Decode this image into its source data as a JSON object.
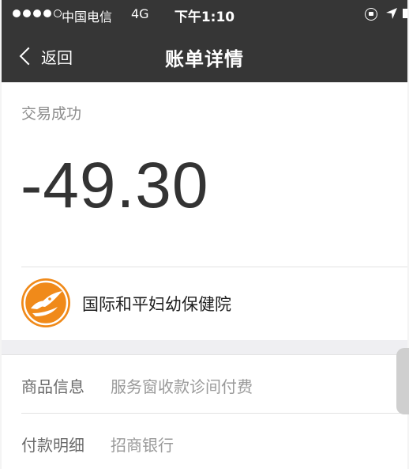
{
  "status_bar": {
    "carrier": "中国电信",
    "network": "4G",
    "time": "下午1:10"
  },
  "nav": {
    "back_label": "返回",
    "title": "账单详情"
  },
  "transaction": {
    "status": "交易成功",
    "amount": "-49.30"
  },
  "merchant": {
    "name": "国际和平妇幼保健院",
    "logo_color": "#f08a1a"
  },
  "details": [
    {
      "label": "商品信息",
      "value": "服务窗收款诊间付费"
    },
    {
      "label": "付款明细",
      "value": "招商银行"
    }
  ],
  "colors": {
    "header_bg": "#363636",
    "section_gap": "#efeff2"
  }
}
